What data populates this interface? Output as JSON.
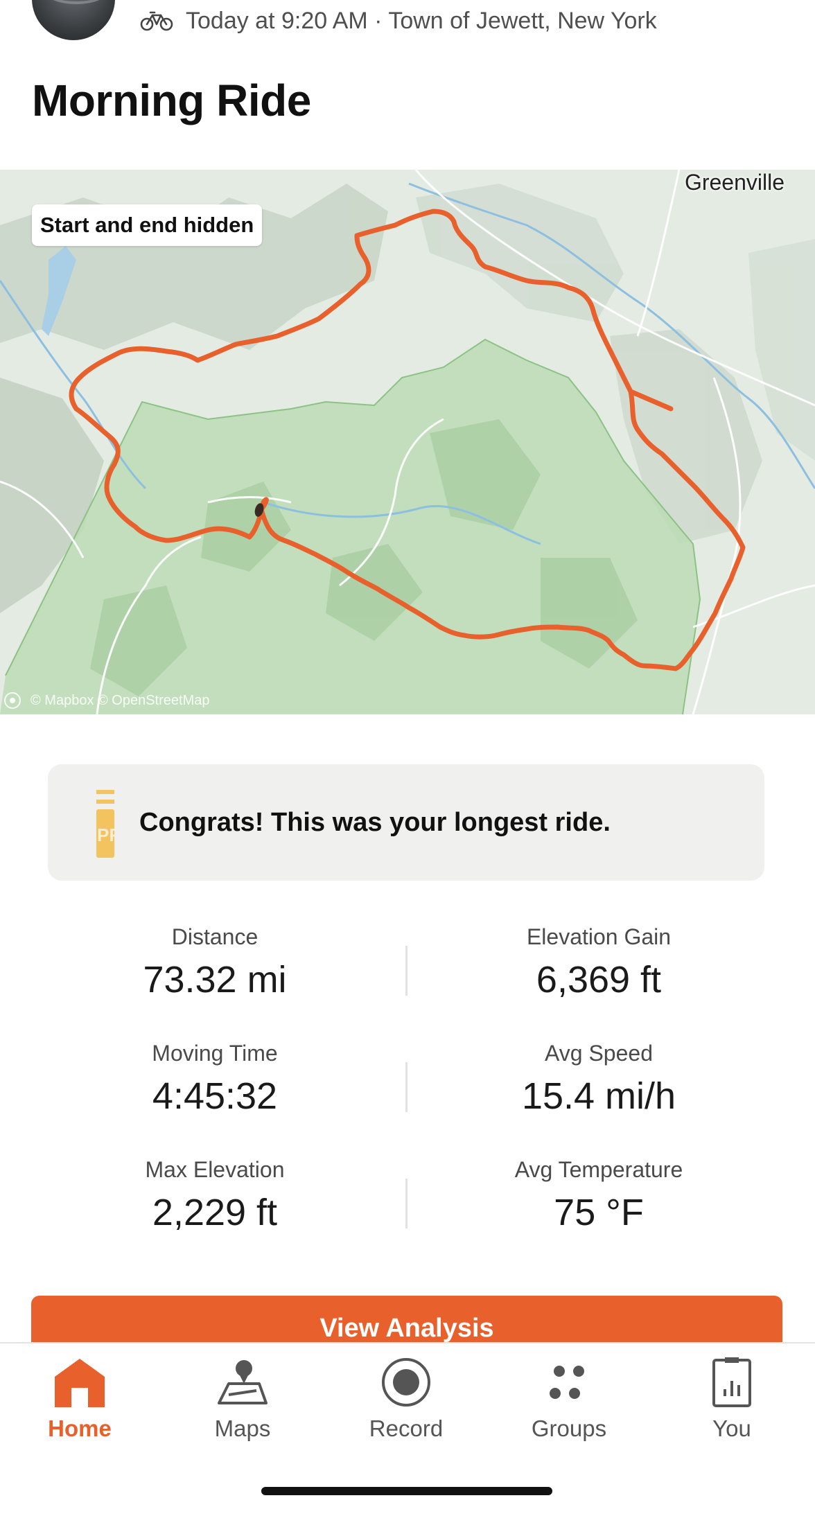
{
  "activity": {
    "meta_text": "Today at 9:20 AM · Town of Jewett, New York",
    "title": "Morning Ride"
  },
  "map": {
    "badge": "Start and end hidden",
    "town_label": "Greenville",
    "attribution": "© Mapbox © OpenStreetMap",
    "route_color": "#e8602c"
  },
  "congrats": {
    "text": "Congrats! This was your longest ride.",
    "icon": "pr-trophy-icon",
    "icon_color": "#f2c35f"
  },
  "stats": [
    {
      "left": {
        "label": "Distance",
        "value": "73.32 mi"
      },
      "right": {
        "label": "Elevation Gain",
        "value": "6,369 ft"
      }
    },
    {
      "left": {
        "label": "Moving Time",
        "value": "4:45:32"
      },
      "right": {
        "label": "Avg Speed",
        "value": "15.4 mi/h"
      }
    },
    {
      "left": {
        "label": "Max Elevation",
        "value": "2,229 ft"
      },
      "right": {
        "label": "Avg Temperature",
        "value": "75 °F"
      }
    }
  ],
  "cta": {
    "label": "View Analysis"
  },
  "tabs": [
    {
      "label": "Home",
      "icon": "home-icon",
      "active": true
    },
    {
      "label": "Maps",
      "icon": "maps-icon",
      "active": false
    },
    {
      "label": "Record",
      "icon": "record-icon",
      "active": false
    },
    {
      "label": "Groups",
      "icon": "groups-icon",
      "active": false
    },
    {
      "label": "You",
      "icon": "you-icon",
      "active": false
    }
  ],
  "colors": {
    "accent": "#e8602c",
    "text": "#1f1f1f",
    "muted": "#4f4f4f"
  }
}
